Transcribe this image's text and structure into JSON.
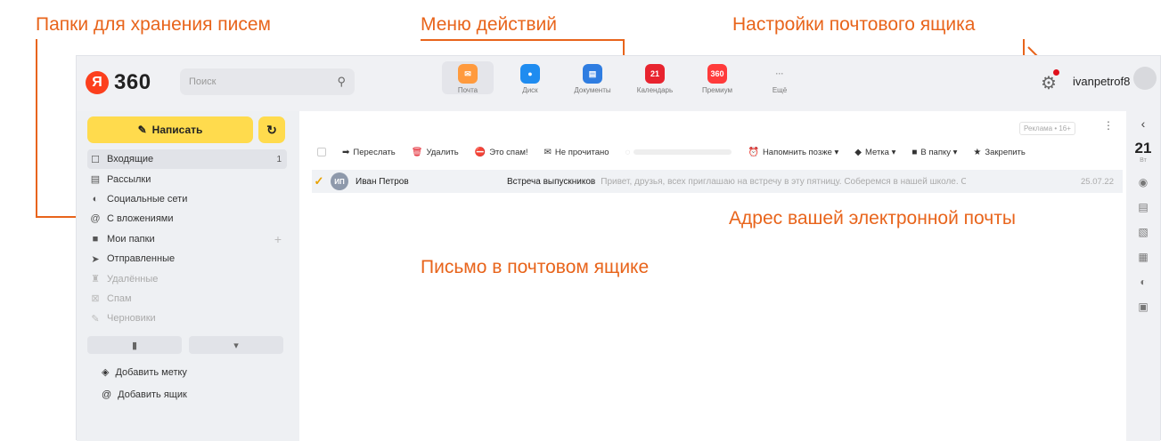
{
  "annotations": {
    "folders": "Папки для хранения писем",
    "menu": "Меню действий",
    "settings": "Настройки почтового ящика",
    "email_address": "Адрес вашей электронной почты",
    "letter": "Письмо в почтовом ящике"
  },
  "colors": {
    "annotation": "#e8641b",
    "compose": "#ffdb4d",
    "logo": "#fc3f1d"
  },
  "header": {
    "logo_letter": "Я",
    "logo_text": "360",
    "search_placeholder": "Поиск",
    "apps": [
      {
        "label": "Почта",
        "icon": "mail-icon",
        "color": "#ff9a3d"
      },
      {
        "label": "Диск",
        "icon": "disk-icon",
        "color": "#1f8cf0"
      },
      {
        "label": "Документы",
        "icon": "documents-icon",
        "color": "#2f7de1"
      },
      {
        "label": "Календарь",
        "icon": "calendar-icon",
        "color": "#e8242f",
        "text": "21"
      },
      {
        "label": "Премиум",
        "icon": "premium-icon",
        "color": "#ff3b3b",
        "text": "360"
      },
      {
        "label": "Ещё",
        "icon": "more-icon",
        "color": "#f0f1f4",
        "text": "···"
      }
    ],
    "username": "ivanpetrof8"
  },
  "sidebar": {
    "compose_label": "Написать",
    "folders": [
      {
        "label": "Входящие",
        "icon": "inbox-icon",
        "count": "1"
      },
      {
        "label": "Рассылки",
        "icon": "newsletters-icon",
        "count": ""
      },
      {
        "label": "Социальные сети",
        "icon": "social-icon",
        "count": ""
      },
      {
        "label": "С вложениями",
        "icon": "attachment-icon",
        "count": ""
      },
      {
        "label": "Мои папки",
        "icon": "folder-icon",
        "count": ""
      },
      {
        "label": "Отправленные",
        "icon": "sent-icon",
        "count": ""
      },
      {
        "label": "Удалённые",
        "icon": "trash-icon",
        "count": ""
      },
      {
        "label": "Спам",
        "icon": "spam-icon",
        "count": ""
      },
      {
        "label": "Черновики",
        "icon": "drafts-icon",
        "count": ""
      }
    ],
    "add_label": "Добавить метку",
    "add_mailbox": "Добавить ящик"
  },
  "main": {
    "ad_label": "Реклама • 16+",
    "toolbar": [
      {
        "label": "Переслать",
        "icon": "forward-icon"
      },
      {
        "label": "Удалить",
        "icon": "delete-icon"
      },
      {
        "label": "Это спам!",
        "icon": "spam-mark-icon"
      },
      {
        "label": "Не прочитано",
        "icon": "unread-icon"
      },
      {
        "label": "",
        "icon": "disabled-action-icon"
      },
      {
        "label": "Напомнить позже ▾",
        "icon": "remind-icon"
      },
      {
        "label": "Метка ▾",
        "icon": "label-icon"
      },
      {
        "label": "В папку ▾",
        "icon": "move-folder-icon"
      },
      {
        "label": "Закрепить",
        "icon": "pin-icon"
      }
    ],
    "email": {
      "avatar_initials": "ИП",
      "sender": "Иван Петров",
      "subject": "Встреча выпускников",
      "preview": "Привет, друзья, всех приглашаю на встречу в эту пятницу. Соберемся в нашей школе. С наилучшими пожеланиями",
      "date": "25.07.22"
    }
  },
  "right_panel": {
    "day": "21",
    "weekday": "Вт"
  }
}
